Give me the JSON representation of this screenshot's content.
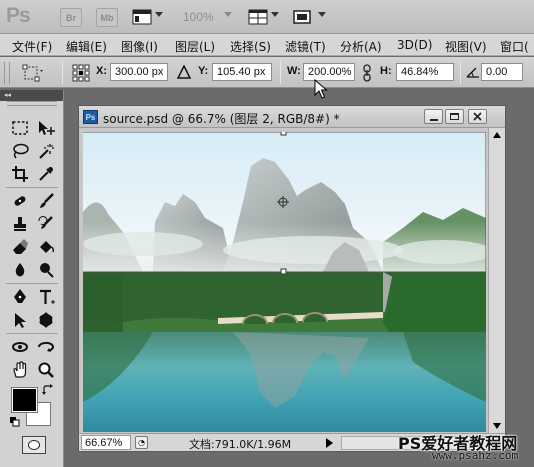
{
  "app": {
    "logo": "Ps",
    "bridge_label": "Br",
    "minibridge_label": "Mb",
    "zoom_level": "100%"
  },
  "menu": [
    {
      "label": "文件(F)"
    },
    {
      "label": "编辑(E)"
    },
    {
      "label": "图像(I)"
    },
    {
      "label": "图层(L)"
    },
    {
      "label": "选择(S)"
    },
    {
      "label": "滤镜(T)"
    },
    {
      "label": "分析(A)"
    },
    {
      "label": "3D(D)"
    },
    {
      "label": "视图(V)"
    },
    {
      "label": "窗口("
    }
  ],
  "options": {
    "x_label": "X:",
    "x_value": "300.00 px",
    "y_label": "Y:",
    "y_value": "105.40 px",
    "w_label": "W:",
    "w_value": "200.00%",
    "h_label": "H:",
    "h_value": "46.84%",
    "angle_value": "0.00"
  },
  "document": {
    "title": "source.psd @ 66.7% (图层 2, RGB/8#) *",
    "ps_icon": "Ps",
    "zoom_display": "66.67%",
    "doc_info": "文档:791.0K/1.96M"
  },
  "tools": [
    "rectangular-marquee-tool",
    "move-tool",
    "lasso-tool",
    "magic-wand-tool",
    "crop-tool",
    "eyedropper-tool",
    "spot-healing-tool",
    "brush-tool",
    "clone-stamp-tool",
    "history-brush-tool",
    "eraser-tool",
    "paint-bucket-tool",
    "blur-tool",
    "dodge-tool",
    "pen-tool",
    "type-tool",
    "path-selection-tool",
    "custom-shape-tool",
    "3d-rotate-tool",
    "3d-orbit-tool",
    "hand-tool",
    "zoom-tool"
  ],
  "colors": {
    "foreground": "#000000",
    "background": "#ffffff"
  },
  "watermark": {
    "title": "PS爱好者教程网",
    "url": "www.psahz.com"
  }
}
